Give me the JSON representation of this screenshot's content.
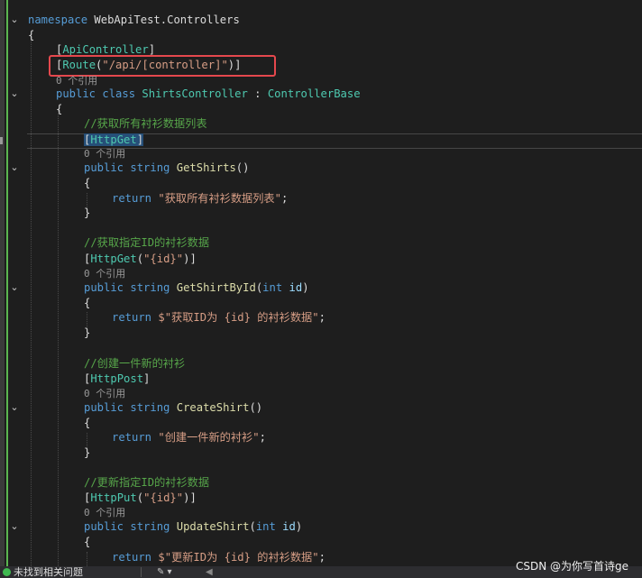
{
  "code": {
    "namespace_kw": "namespace",
    "namespace_name": "WebApiTest.Controllers",
    "brace_open": "{",
    "brace_close": "}",
    "attr_apicontroller": "ApiController",
    "route_attr": "Route",
    "route_value": "\"/api/[controller]\"",
    "class_refs": "0 个引用",
    "public_kw": "public",
    "class_kw": "class",
    "class_name": "ShirtsController",
    "colon": ":",
    "base_class": "ControllerBase",
    "string_kw": "string",
    "int_kw": "int",
    "return_kw": "return",
    "param_id": "id",
    "methods": [
      {
        "comment": "//获取所有衬衫数据列表",
        "attr": "HttpGet",
        "attr_arg": "",
        "refs": "0 个引用",
        "name": "GetShirts",
        "has_param": false,
        "return_value": "\"获取所有衬衫数据列表\""
      },
      {
        "comment": "//获取指定ID的衬衫数据",
        "attr": "HttpGet",
        "attr_arg": "\"{id}\"",
        "refs": "0 个引用",
        "name": "GetShirtById",
        "has_param": true,
        "return_value": "$\"获取ID为 {id} 的衬衫数据\""
      },
      {
        "comment": "//创建一件新的衬衫",
        "attr": "HttpPost",
        "attr_arg": "",
        "refs": "0 个引用",
        "name": "CreateShirt",
        "has_param": false,
        "return_value": "\"创建一件新的衬衫\""
      },
      {
        "comment": "//更新指定ID的衬衫数据",
        "attr": "HttpPut",
        "attr_arg": "\"{id}\"",
        "refs": "0 个引用",
        "name": "UpdateShirt",
        "has_param": true,
        "return_value": "$\"更新ID为 {id} 的衬衫数据\""
      }
    ]
  },
  "status": {
    "issues_text": "未找到相关问题",
    "tool_glyph": "✎ ▾",
    "scroll_glyph": "◀"
  },
  "watermark": "CSDN @为你写首诗ge",
  "colors": {
    "background": "#1e1e1e",
    "keyword": "#569cd6",
    "type": "#4ec9b0",
    "method": "#dcdcaa",
    "string": "#d69d85",
    "comment": "#57a64a",
    "highlight_box": "#e5484d",
    "change_bar": "#5bb550"
  }
}
